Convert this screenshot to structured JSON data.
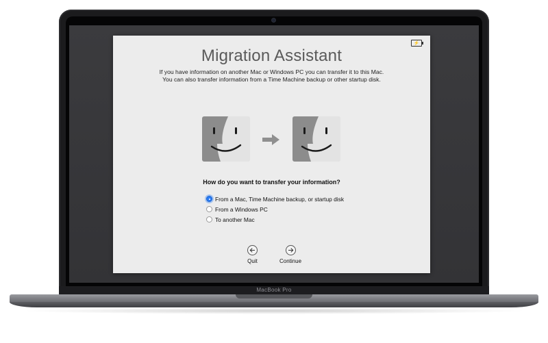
{
  "device": {
    "brand_label": "MacBook Pro"
  },
  "window": {
    "title": "Migration Assistant",
    "description_lines": [
      "If you have information on another Mac or Windows PC you can transfer it to this Mac.",
      "You can also transfer information from a Time Machine backup or other startup disk."
    ],
    "question": "How do you want to transfer your information?",
    "options": [
      {
        "label": "From a Mac, Time Machine backup, or startup disk",
        "selected": true
      },
      {
        "label": "From a Windows PC",
        "selected": false
      },
      {
        "label": "To another Mac",
        "selected": false
      }
    ],
    "buttons": {
      "quit_label": "Quit",
      "continue_label": "Continue"
    }
  },
  "icons": {
    "source": "finder-icon",
    "arrow": "arrow-right-icon",
    "destination": "finder-icon",
    "battery": "battery-charging-icon"
  },
  "colors": {
    "accent": "#2a7cf4",
    "window_bg": "#ececec",
    "desktop_bg": "#38383b"
  }
}
